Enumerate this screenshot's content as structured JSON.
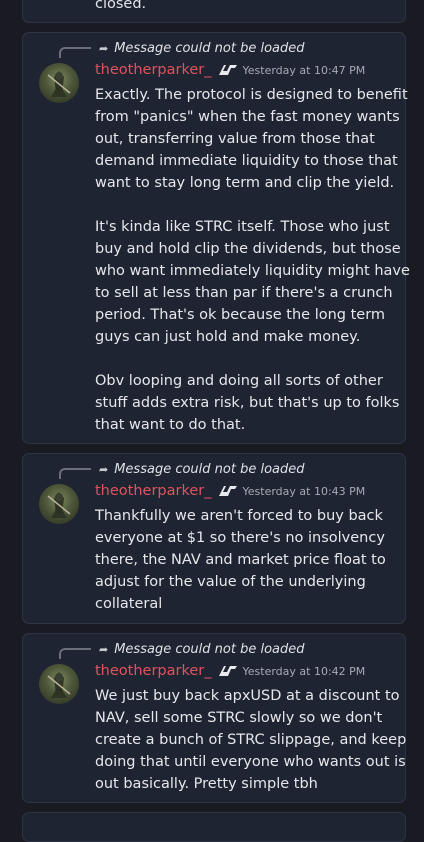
{
  "top_message": {
    "text": "closed."
  },
  "messages": [
    {
      "reply_text": "Message could not be loaded",
      "username": "theotherparker_",
      "timestamp": "Yesterday at 10:47 PM",
      "paragraphs": [
        [
          "Exactly. The protocol is designed to benefit",
          "from \"panics\" when the fast money wants",
          "out, transferring value from those that",
          "demand immediate liquidity to those that",
          "want to stay long term and clip the yield."
        ],
        [
          "It's kinda like STRC itself. Those who just",
          "buy and hold clip the dividends, but those",
          "who want immediately liquidity might have",
          "to sell at less than par if there's a crunch",
          "period. That's ok because the long term",
          "guys can just hold and make money."
        ],
        [
          "Obv looping and doing all sorts of other",
          "stuff adds extra risk, but that's up to folks",
          "that want to do that."
        ]
      ]
    },
    {
      "reply_text": "Message could not be loaded",
      "username": "theotherparker_",
      "timestamp": "Yesterday at 10:43 PM",
      "paragraphs": [
        [
          "Thankfully we aren't forced to buy back",
          "everyone at $1 so there's no insolvency",
          "there, the NAV and market price float to",
          "adjust for the value of the underlying",
          "collateral"
        ]
      ]
    },
    {
      "reply_text": "Message could not be loaded",
      "username": "theotherparker_",
      "timestamp": "Yesterday at 10:42 PM",
      "paragraphs": [
        [
          "We just buy back apxUSD at a discount to",
          "NAV, sell some STRC slowly so we don't",
          "create a bunch of STRC slippage, and keep",
          "doing that until everyone who wants out is",
          "out basically. Pretty simple tbh"
        ]
      ]
    }
  ],
  "colors": {
    "background": "#1a1b22",
    "card": "#1f2432",
    "username": "#e0535d",
    "text": "#e6e7eb",
    "timestamp": "#a7aab3"
  },
  "icons": {
    "reply": "reply-arrow-icon",
    "badge": "guild-tag-icon",
    "avatar": "knight-avatar"
  }
}
